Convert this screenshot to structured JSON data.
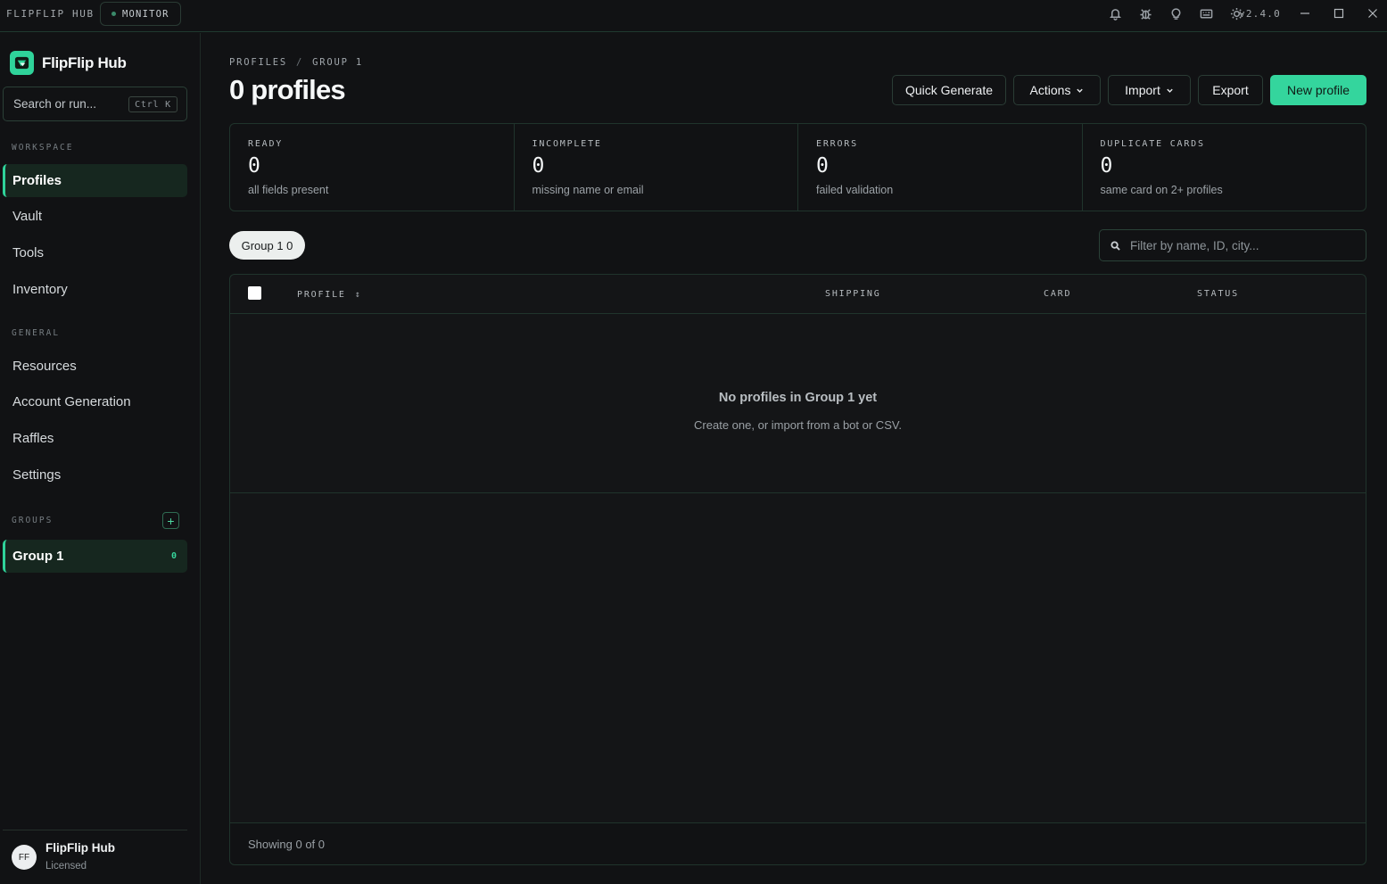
{
  "titlebar": {
    "app_name": "FLIPFLIP HUB",
    "monitor_label": "MONITOR",
    "version": "v2.4.0",
    "icons": [
      "bell-icon",
      "bug-icon",
      "lightbulb-icon",
      "keyboard-icon",
      "sun-icon"
    ]
  },
  "sidebar": {
    "brand_name": "FlipFlip Hub",
    "search_placeholder": "Search or run...",
    "search_shortcut": "Ctrl K",
    "workspace_label": "WORKSPACE",
    "workspace_items": [
      {
        "label": "Profiles",
        "active": true
      },
      {
        "label": "Vault"
      },
      {
        "label": "Tools"
      },
      {
        "label": "Inventory"
      }
    ],
    "general_label": "GENERAL",
    "general_items": [
      {
        "label": "Resources"
      },
      {
        "label": "Account Generation"
      },
      {
        "label": "Raffles"
      },
      {
        "label": "Settings"
      }
    ],
    "groups_label": "GROUPS",
    "add_group_symbol": "+",
    "groups": [
      {
        "label": "Group 1",
        "count": "0",
        "active": true
      }
    ],
    "user": {
      "initials": "FF",
      "name": "FlipFlip Hub",
      "status": "Licensed"
    }
  },
  "main": {
    "breadcrumb": [
      "PROFILES",
      "GROUP 1"
    ],
    "breadcrumb_sep": "/",
    "title": "0 profiles",
    "buttons": {
      "quick_generate": "Quick Generate",
      "actions": "Actions",
      "import": "Import",
      "export": "Export",
      "new_profile": "New profile"
    },
    "stats": [
      {
        "label": "READY",
        "value": "0",
        "desc": "all fields present"
      },
      {
        "label": "INCOMPLETE",
        "value": "0",
        "desc": "missing name or email"
      },
      {
        "label": "ERRORS",
        "value": "0",
        "desc": "failed validation"
      },
      {
        "label": "DUPLICATE CARDS",
        "value": "0",
        "desc": "same card on 2+ profiles"
      }
    ],
    "group_chip": "Group 1 0",
    "filter_placeholder": "Filter by name, ID, city...",
    "table": {
      "columns": [
        "PROFILE",
        "SHIPPING",
        "CARD",
        "STATUS"
      ],
      "sort_symbol": "↕",
      "empty_title": "No profiles in Group 1 yet",
      "empty_subtitle": "Create one, or import from a bot or CSV.",
      "footer": "Showing 0 of 0"
    }
  },
  "colors": {
    "accent": "#34d59d",
    "background": "#111214",
    "border": "#20342c"
  }
}
